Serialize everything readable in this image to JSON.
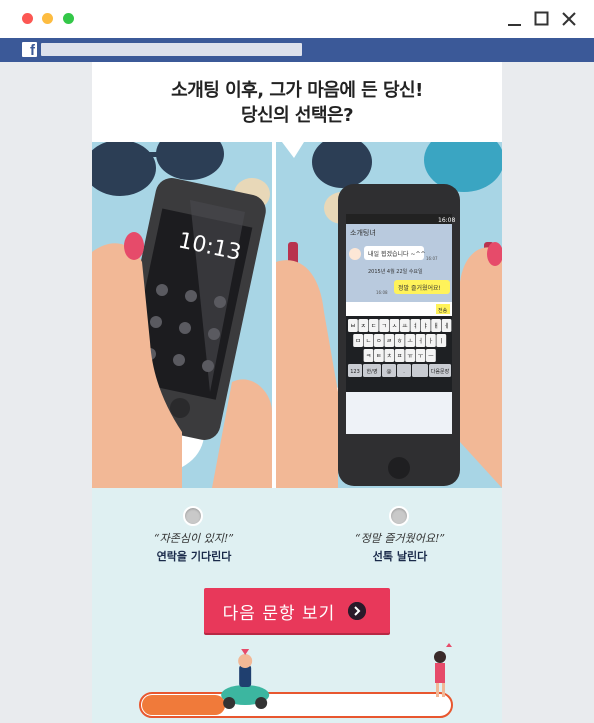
{
  "window": {
    "controls": [
      "minimize-icon",
      "maximize-icon",
      "close-icon"
    ]
  },
  "facebook_bar": {
    "logo_text": "f"
  },
  "quiz": {
    "question_line1": "소개팅 이후, 그가 마음에 든 당신!",
    "question_line2": "당신의 선택은?",
    "phone_left": {
      "clock": "10:13"
    },
    "phone_right": {
      "status_time": "16:08",
      "chat_title": "소개팅녀",
      "received_message": "내일 뵙겠습니다 ~^^",
      "received_time": "16:07",
      "date_divider": "2015년 4월 22일 수요일",
      "sent_message": "정말 즐거웠어요!",
      "sent_time": "16:08",
      "send_button": "전송",
      "keyboard_rows": [
        [
          "ㅂ",
          "ㅈ",
          "ㄷ",
          "ㄱ",
          "ㅅ",
          "ㅛ",
          "ㅕ",
          "ㅑ",
          "ㅐ",
          "ㅔ"
        ],
        [
          "ㅁ",
          "ㄴ",
          "ㅇ",
          "ㄹ",
          "ㅎ",
          "ㅗ",
          "ㅓ",
          "ㅏ",
          "ㅣ"
        ],
        [
          "ㅋ",
          "ㅌ",
          "ㅊ",
          "ㅍ",
          "ㅠ",
          "ㅜ",
          "ㅡ"
        ]
      ],
      "kb_123": "123",
      "kb_lang": "한/영",
      "kb_at": "@",
      "kb_dot": ".",
      "kb_enter": "다음문장"
    },
    "choices": [
      {
        "quote": "“자존심이 있지!”",
        "caption": "연락을 기다린다"
      },
      {
        "quote": "“정말 즐거웠어요!”",
        "caption": "선톡 날린다"
      }
    ],
    "next_button": "다음 문항 보기",
    "progress": 0.27,
    "colors": {
      "accent": "#e8385a",
      "facebook": "#3b5998",
      "panel": "#dff0f2",
      "illustration_bg": "#a8d5e5"
    }
  }
}
